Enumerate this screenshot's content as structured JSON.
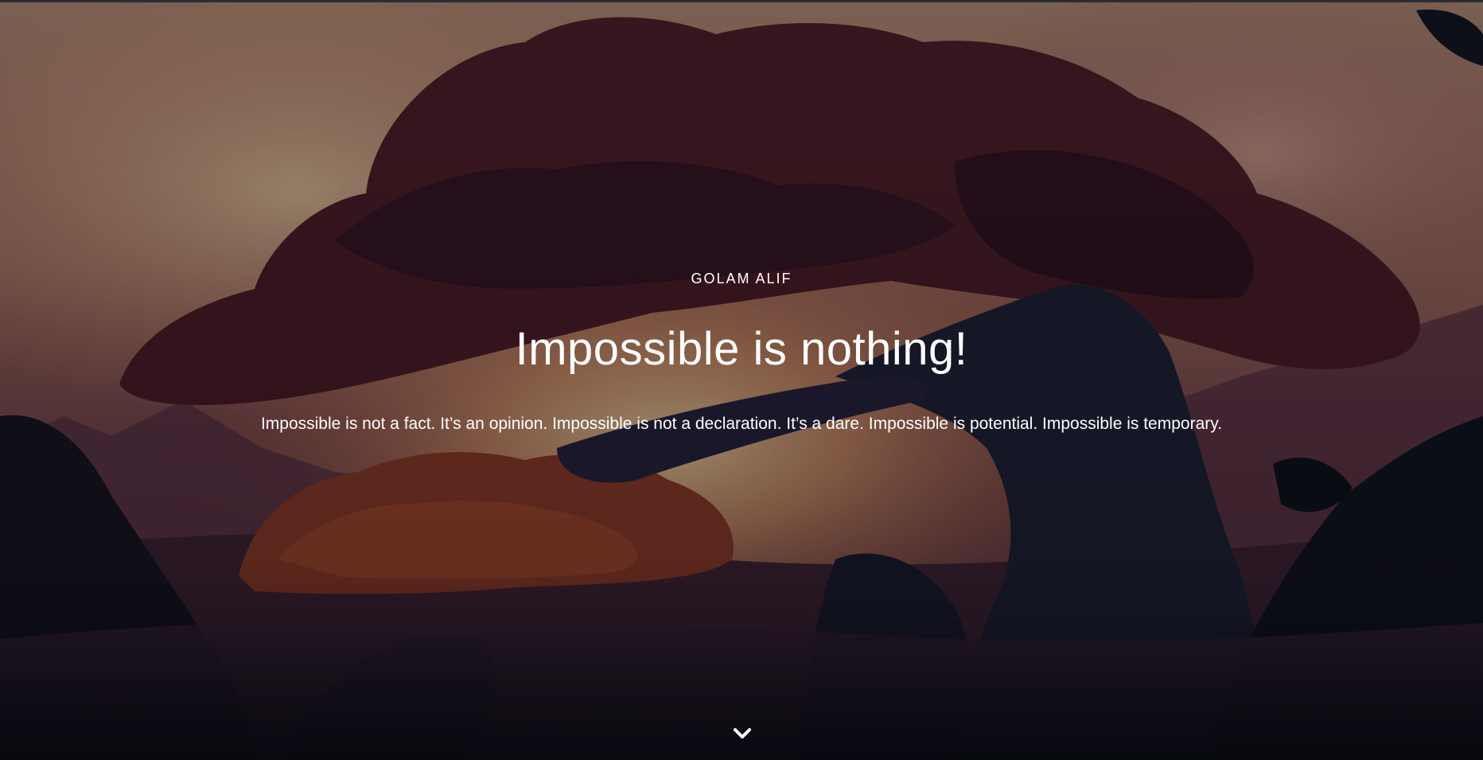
{
  "hero": {
    "eyebrow": "GOLAM ALIF",
    "headline": "Impossible is nothing!",
    "subtext": "Impossible is not a fact. It’s an opinion. Impossible is not a declaration. It’s a dare. Impossible is potential. Impossible is temporary.",
    "scroll_icon": "chevron-down-icon"
  },
  "colors": {
    "text": "#ffffff",
    "sky_light": "#e8c49a",
    "sky_mid": "#b85a45",
    "canopy": "#4a1a22",
    "ground_dark": "#121826"
  }
}
